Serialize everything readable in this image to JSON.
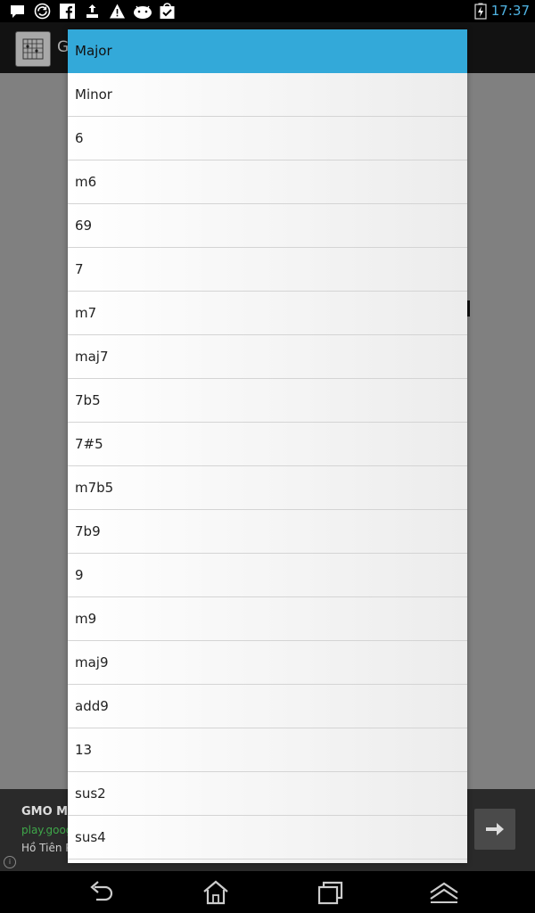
{
  "status_bar": {
    "time": "17:37",
    "icons": [
      "message-icon",
      "sync-icon",
      "facebook-icon",
      "upload-icon",
      "warning-icon",
      "android-icon",
      "check-bag-icon"
    ],
    "battery_icon": "battery-charging-icon"
  },
  "app": {
    "title": "G",
    "icon": "chord-grid-icon"
  },
  "ad": {
    "title": "GMO Mi",
    "url": "play.goog",
    "subtitle": "Hồ Tiên P",
    "info_symbol": "i"
  },
  "colors": {
    "selected": "#33a9d9",
    "time": "#4fb3e3"
  },
  "dialog": {
    "selected_index": 0,
    "options": [
      "Major",
      "Minor",
      "6",
      "m6",
      "69",
      "7",
      "m7",
      "maj7",
      "7b5",
      "7#5",
      "m7b5",
      "7b9",
      "9",
      "m9",
      "maj9",
      "add9",
      "13",
      "sus2",
      "sus4"
    ]
  },
  "nav": {
    "icons": [
      "back-icon",
      "home-icon",
      "recent-apps-icon",
      "menu-up-icon"
    ]
  }
}
